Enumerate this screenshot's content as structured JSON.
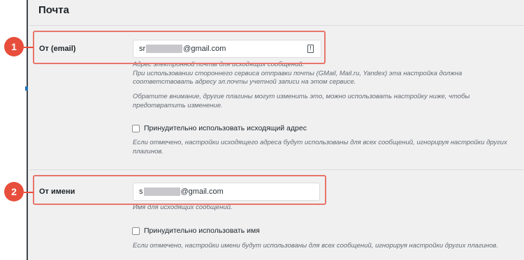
{
  "section": {
    "title": "Почта"
  },
  "from_email": {
    "label": "От (email)",
    "value_prefix": "sr",
    "value_suffix": "@gmail.com",
    "field_icon": "info-icon",
    "field_icon_glyph": "!",
    "desc_1": "Адрес электронной почты для исходящих сообщений.",
    "desc_2": "При использовании стороннего сервиса отправки почты (GMail, Mail.ru, Yandex) эта настройка должна",
    "desc_3": "соответствовать адресу эл.почты учетной записи на этом сервисе.",
    "desc_4": "Обратите внимание, другие плагины могут изменить это, можно использовать настройку ниже, чтобы",
    "desc_5": "предотвратить изменение.",
    "force_label": "Принудительно использовать исходящий адрес",
    "force_desc_1": "Если отмечено, настройки исходящего адреса будут использованы для всех сообщений, игнорируя настройки других",
    "force_desc_2": "плагинов."
  },
  "from_name": {
    "label": "От имени",
    "value_prefix": "s",
    "value_suffix": "@gmail.com",
    "desc": "Имя для исходящих сообщений.",
    "force_label": "Принудительно использовать имя",
    "force_desc": "Если отмечено, настройки имени будут использованы для всех сообщений, игнорируя настройки других плагинов."
  },
  "annotations": {
    "marker_1": "1",
    "marker_2": "2",
    "color": "#e84e3c"
  }
}
